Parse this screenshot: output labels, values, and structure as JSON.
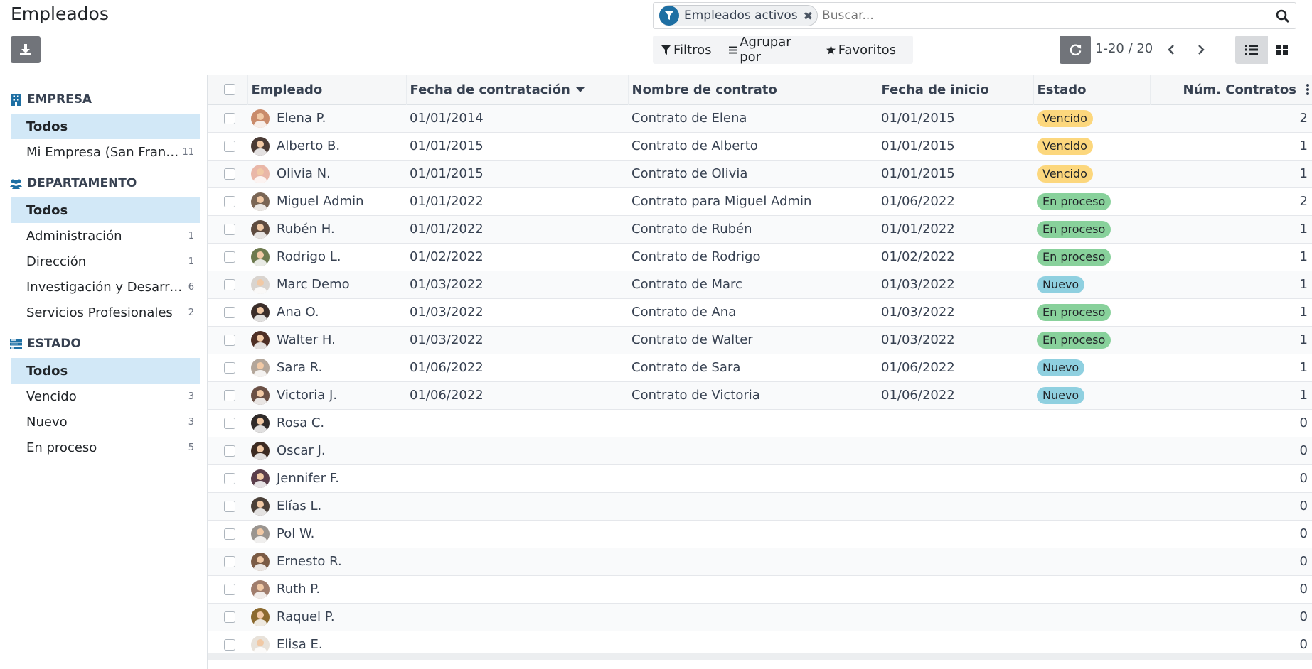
{
  "page": {
    "title": "Empleados"
  },
  "search": {
    "facet_label": "Empleados activos",
    "facet_remove": "✖",
    "placeholder": "Buscar..."
  },
  "filterbar": {
    "filters": "Filtros",
    "group_by": "Agrupar por",
    "favorites": "Favoritos"
  },
  "pager": {
    "value": "1-20 / 20"
  },
  "sidebar": {
    "sections": [
      {
        "title": "EMPRESA",
        "icon": "building-icon",
        "items": [
          {
            "label": "Todos",
            "count": "",
            "active": true
          },
          {
            "label": "Mi Empresa (San Francisco)",
            "count": "11",
            "active": false
          }
        ]
      },
      {
        "title": "DEPARTAMENTO",
        "icon": "users-icon",
        "items": [
          {
            "label": "Todos",
            "count": "",
            "active": true
          },
          {
            "label": "Administración",
            "count": "1",
            "active": false
          },
          {
            "label": "Dirección",
            "count": "1",
            "active": false
          },
          {
            "label": "Investigación y Desarrollo",
            "count": "6",
            "active": false
          },
          {
            "label": "Servicios Profesionales",
            "count": "2",
            "active": false
          }
        ]
      },
      {
        "title": "ESTADO",
        "icon": "tasks-icon",
        "items": [
          {
            "label": "Todos",
            "count": "",
            "active": true
          },
          {
            "label": "Vencido",
            "count": "3",
            "active": false
          },
          {
            "label": "Nuevo",
            "count": "3",
            "active": false
          },
          {
            "label": "En proceso",
            "count": "5",
            "active": false
          }
        ]
      }
    ]
  },
  "table": {
    "columns": [
      "Empleado",
      "Fecha de contratación",
      "Nombre de contrato",
      "Fecha de inicio",
      "Estado",
      "Núm. Contratos"
    ],
    "rows": [
      {
        "name": "Elena P.",
        "hire": "01/01/2014",
        "contract": "Contrato de Elena",
        "start": "01/01/2015",
        "state": "Vencido",
        "count": "2",
        "avatar": "#c98b6b"
      },
      {
        "name": "Alberto B.",
        "hire": "01/01/2015",
        "contract": "Contrato de Alberto",
        "start": "01/01/2015",
        "state": "Vencido",
        "count": "1",
        "avatar": "#4a3b35"
      },
      {
        "name": "Olivia N.",
        "hire": "01/01/2015",
        "contract": "Contrato de Olivia",
        "start": "01/01/2015",
        "state": "Vencido",
        "count": "1",
        "avatar": "#e9b7a8"
      },
      {
        "name": "Miguel Admin",
        "hire": "01/01/2022",
        "contract": "Contrato para Miguel Admin",
        "start": "01/06/2022",
        "state": "En proceso",
        "count": "2",
        "avatar": "#7a6655"
      },
      {
        "name": "Rubén H.",
        "hire": "01/01/2022",
        "contract": "Contrato de Rubén",
        "start": "01/01/2022",
        "state": "En proceso",
        "count": "1",
        "avatar": "#5e4b3f"
      },
      {
        "name": "Rodrigo L.",
        "hire": "01/02/2022",
        "contract": "Contrato de Rodrigo",
        "start": "01/02/2022",
        "state": "En proceso",
        "count": "1",
        "avatar": "#6d7a4f"
      },
      {
        "name": "Marc Demo",
        "hire": "01/03/2022",
        "contract": "Contrato de Marc",
        "start": "01/03/2022",
        "state": "Nuevo",
        "count": "1",
        "avatar": "#d9d4cf"
      },
      {
        "name": "Ana O.",
        "hire": "01/03/2022",
        "contract": "Contrato de Ana",
        "start": "01/03/2022",
        "state": "En proceso",
        "count": "1",
        "avatar": "#3b2e2a"
      },
      {
        "name": "Walter H.",
        "hire": "01/03/2022",
        "contract": "Contrato de Walter",
        "start": "01/03/2022",
        "state": "En proceso",
        "count": "1",
        "avatar": "#4e2f25"
      },
      {
        "name": "Sara R.",
        "hire": "01/06/2022",
        "contract": "Contrato de Sara",
        "start": "01/06/2022",
        "state": "Nuevo",
        "count": "1",
        "avatar": "#b3a69a"
      },
      {
        "name": "Victoria J.",
        "hire": "01/06/2022",
        "contract": "Contrato de Victoria",
        "start": "01/06/2022",
        "state": "Nuevo",
        "count": "1",
        "avatar": "#6a5045"
      },
      {
        "name": "Rosa C.",
        "hire": "",
        "contract": "",
        "start": "",
        "state": "",
        "count": "0",
        "avatar": "#2f2a29"
      },
      {
        "name": "Oscar J.",
        "hire": "",
        "contract": "",
        "start": "",
        "state": "",
        "count": "0",
        "avatar": "#3d2b22"
      },
      {
        "name": "Jennifer F.",
        "hire": "",
        "contract": "",
        "start": "",
        "state": "",
        "count": "0",
        "avatar": "#5a3d4a"
      },
      {
        "name": "Elías L.",
        "hire": "",
        "contract": "",
        "start": "",
        "state": "",
        "count": "0",
        "avatar": "#4b4038"
      },
      {
        "name": "Pol W.",
        "hire": "",
        "contract": "",
        "start": "",
        "state": "",
        "count": "0",
        "avatar": "#9a9590"
      },
      {
        "name": "Ernesto R.",
        "hire": "",
        "contract": "",
        "start": "",
        "state": "",
        "count": "0",
        "avatar": "#7b5b45"
      },
      {
        "name": "Ruth P.",
        "hire": "",
        "contract": "",
        "start": "",
        "state": "",
        "count": "0",
        "avatar": "#a07d6c"
      },
      {
        "name": "Raquel P.",
        "hire": "",
        "contract": "",
        "start": "",
        "state": "",
        "count": "0",
        "avatar": "#8b6a2f"
      },
      {
        "name": "Elisa E.",
        "hire": "",
        "contract": "",
        "start": "",
        "state": "",
        "count": "0",
        "avatar": "#e8e2da"
      }
    ]
  },
  "colors": {
    "accent": "#1e6fa3",
    "state_vencido": "#fcd77d",
    "state_en_proceso": "#88d19b",
    "state_nuevo": "#8fd0e0",
    "sidebar_active": "#d2e8f7"
  }
}
